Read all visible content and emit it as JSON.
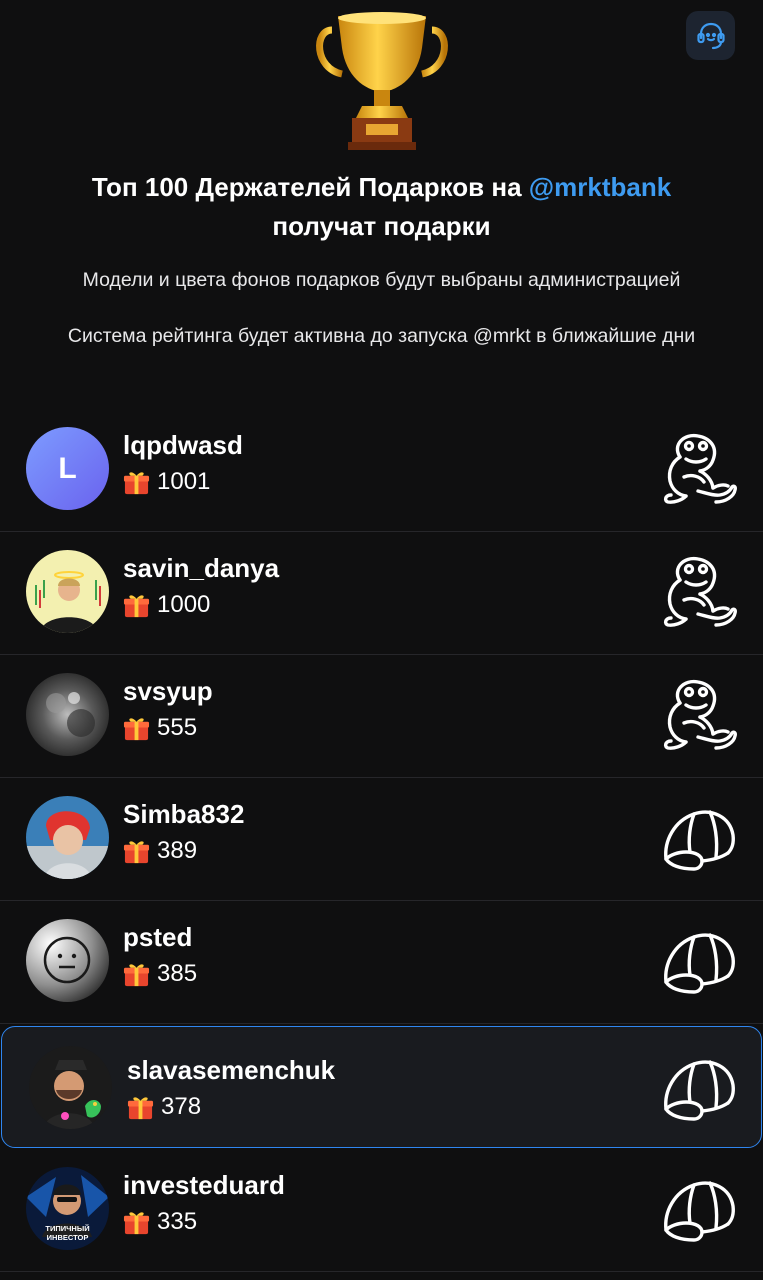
{
  "header": {
    "title_part1": "Топ 100 Держателей Подарков на ",
    "title_handle": "@mrktbank",
    "title_line2": "получат подарки",
    "note1": "Модели и цвета фонов подарков будут выбраны администрацией",
    "note2": "Система рейтинга будет активна до запуска @mrkt в ближайшие дни",
    "support_icon": "support-headset-icon",
    "trophy_icon": "trophy-icon"
  },
  "colors": {
    "background": "#0f0f10",
    "accent": "#3e9bf0",
    "highlight_border": "#2f86f0"
  },
  "leaderboard": [
    {
      "username": "lqpdwasd",
      "count": "1001",
      "avatar_letter": "L",
      "badge_icon": "frog-sticker-icon",
      "highlighted": false
    },
    {
      "username": "savin_danya",
      "count": "1000",
      "avatar_letter": "",
      "badge_icon": "frog-sticker-icon",
      "highlighted": false
    },
    {
      "username": "svsyup",
      "count": "555",
      "avatar_letter": "",
      "badge_icon": "frog-sticker-icon",
      "highlighted": false
    },
    {
      "username": "Simba832",
      "count": "389",
      "avatar_letter": "",
      "badge_icon": "cap-icon",
      "highlighted": false
    },
    {
      "username": "psted",
      "count": "385",
      "avatar_letter": "",
      "badge_icon": "cap-icon",
      "highlighted": false
    },
    {
      "username": "slavasemenchuk",
      "count": "378",
      "avatar_letter": "",
      "badge_icon": "cap-icon",
      "highlighted": true
    },
    {
      "username": "investeduard",
      "count": "335",
      "avatar_letter": "",
      "avatar_caption": "ТИПИЧНЫЙ ИНВЕСТОР",
      "badge_icon": "cap-icon",
      "highlighted": false
    }
  ]
}
